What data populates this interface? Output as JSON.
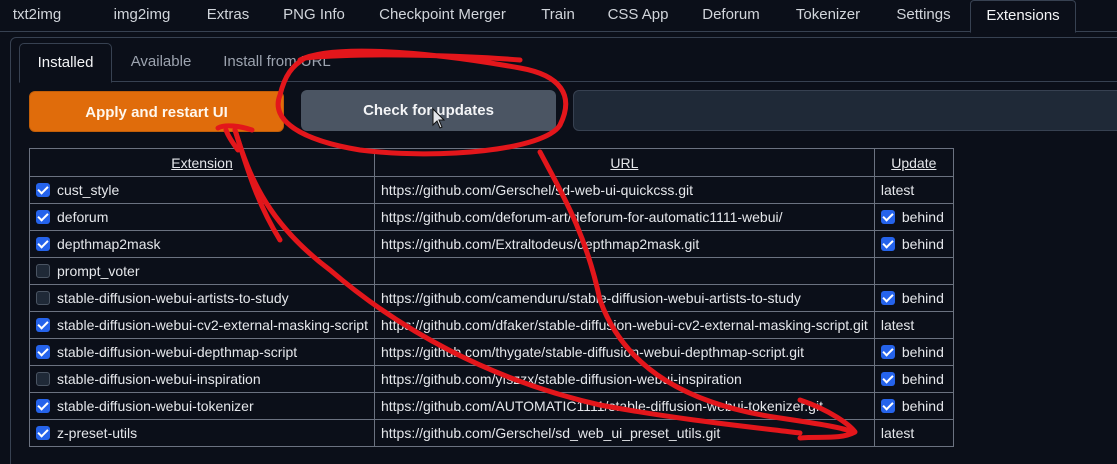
{
  "top_tabs": [
    "txt2img",
    "img2img",
    "Extras",
    "PNG Info",
    "Checkpoint Merger",
    "Train",
    "CSS App",
    "Deforum",
    "Tokenizer",
    "Settings",
    "Extensions"
  ],
  "sub_tabs": [
    "Installed",
    "Available",
    "Install from URL"
  ],
  "buttons": {
    "apply": "Apply and restart UI",
    "check": "Check for updates"
  },
  "table": {
    "headers": [
      "Extension",
      "URL",
      "Update"
    ],
    "rows": [
      {
        "checked": true,
        "name": "cust_style",
        "url": "https://github.com/Gerschel/sd-web-ui-quickcss.git",
        "update": "latest",
        "update_checked": null
      },
      {
        "checked": true,
        "name": "deforum",
        "url": "https://github.com/deforum-art/deforum-for-automatic1111-webui/",
        "update": "behind",
        "update_checked": true
      },
      {
        "checked": true,
        "name": "depthmap2mask",
        "url": "https://github.com/Extraltodeus/depthmap2mask.git",
        "update": "behind",
        "update_checked": true
      },
      {
        "checked": false,
        "name": "prompt_voter",
        "url": "",
        "update": "",
        "update_checked": null
      },
      {
        "checked": false,
        "name": "stable-diffusion-webui-artists-to-study",
        "url": "https://github.com/camenduru/stable-diffusion-webui-artists-to-study",
        "update": "behind",
        "update_checked": true
      },
      {
        "checked": true,
        "name": "stable-diffusion-webui-cv2-external-masking-script",
        "url": "https://github.com/dfaker/stable-diffusion-webui-cv2-external-masking-script.git",
        "update": "latest",
        "update_checked": null
      },
      {
        "checked": true,
        "name": "stable-diffusion-webui-depthmap-script",
        "url": "https://github.com/thygate/stable-diffusion-webui-depthmap-script.git",
        "update": "behind",
        "update_checked": true
      },
      {
        "checked": false,
        "name": "stable-diffusion-webui-inspiration",
        "url": "https://github.com/yfszzx/stable-diffusion-webui-inspiration",
        "update": "behind",
        "update_checked": true
      },
      {
        "checked": true,
        "name": "stable-diffusion-webui-tokenizer",
        "url": "https://github.com/AUTOMATIC1111/stable-diffusion-webui-tokenizer.git",
        "update": "behind",
        "update_checked": true
      },
      {
        "checked": true,
        "name": "z-preset-utils",
        "url": "https://github.com/Gerschel/sd_web_ui_preset_utils.git",
        "update": "latest",
        "update_checked": null
      }
    ]
  },
  "colors": {
    "accent_orange": "#e06c0b",
    "checkbox_blue": "#2563eb",
    "annotation_red": "#e3161b"
  }
}
